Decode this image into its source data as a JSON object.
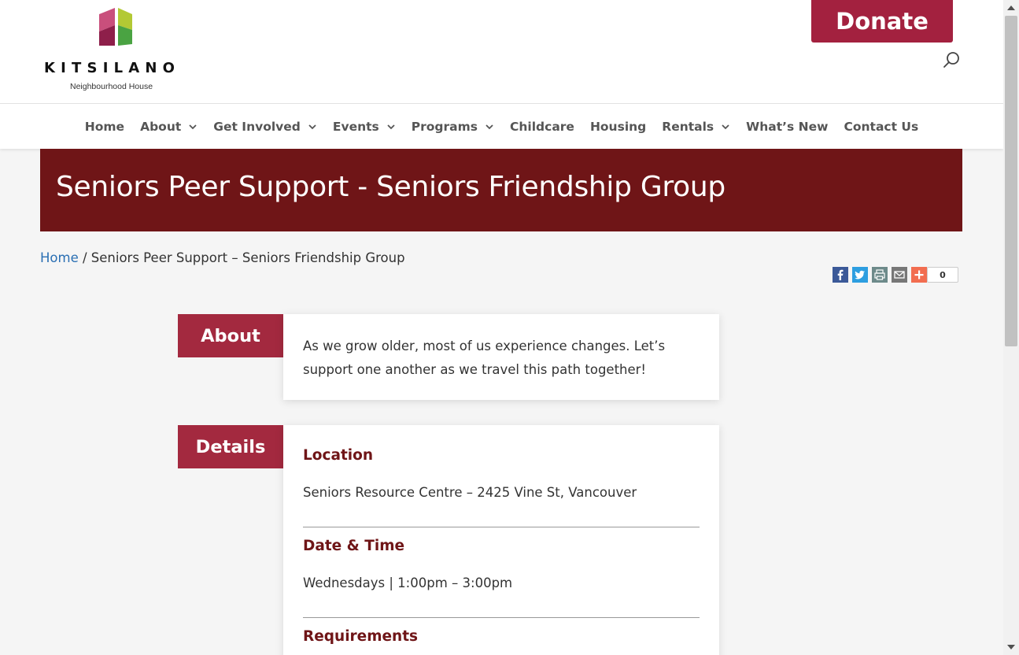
{
  "header": {
    "logo_word": "KITSILANO",
    "logo_sub": "Neighbourhood House",
    "donate_label": "Donate",
    "accent_color": "#a3213f"
  },
  "nav": {
    "items": [
      {
        "label": "Home",
        "has_dropdown": false
      },
      {
        "label": "About",
        "has_dropdown": true
      },
      {
        "label": "Get Involved",
        "has_dropdown": true
      },
      {
        "label": "Events",
        "has_dropdown": true
      },
      {
        "label": "Programs",
        "has_dropdown": true
      },
      {
        "label": "Childcare",
        "has_dropdown": false
      },
      {
        "label": "Housing",
        "has_dropdown": false
      },
      {
        "label": "Rentals",
        "has_dropdown": true
      },
      {
        "label": "What’s New",
        "has_dropdown": false
      },
      {
        "label": "Contact Us",
        "has_dropdown": false
      }
    ]
  },
  "hero": {
    "title": "Seniors Peer Support - Seniors Friendship Group",
    "bg_color": "#6f1517"
  },
  "breadcrumb": {
    "home": "Home",
    "separator": " / ",
    "current": "Seniors Peer Support – Seniors Friendship Group"
  },
  "share": {
    "buttons": [
      "facebook-icon",
      "twitter-icon",
      "print-icon",
      "email-icon",
      "plus-icon"
    ],
    "count": "0"
  },
  "about": {
    "tag": "About",
    "text": "As we grow older, most of us experience changes. Let’s support one another as we travel this path together!"
  },
  "details": {
    "tag": "Details",
    "location_label": "Location",
    "location_value": "Seniors Resource Centre – 2425 Vine St, Vancouver",
    "datetime_label": "Date & Time",
    "datetime_value": "Wednesdays | 1:00pm – 3:00pm",
    "requirements_label": "Requirements"
  }
}
